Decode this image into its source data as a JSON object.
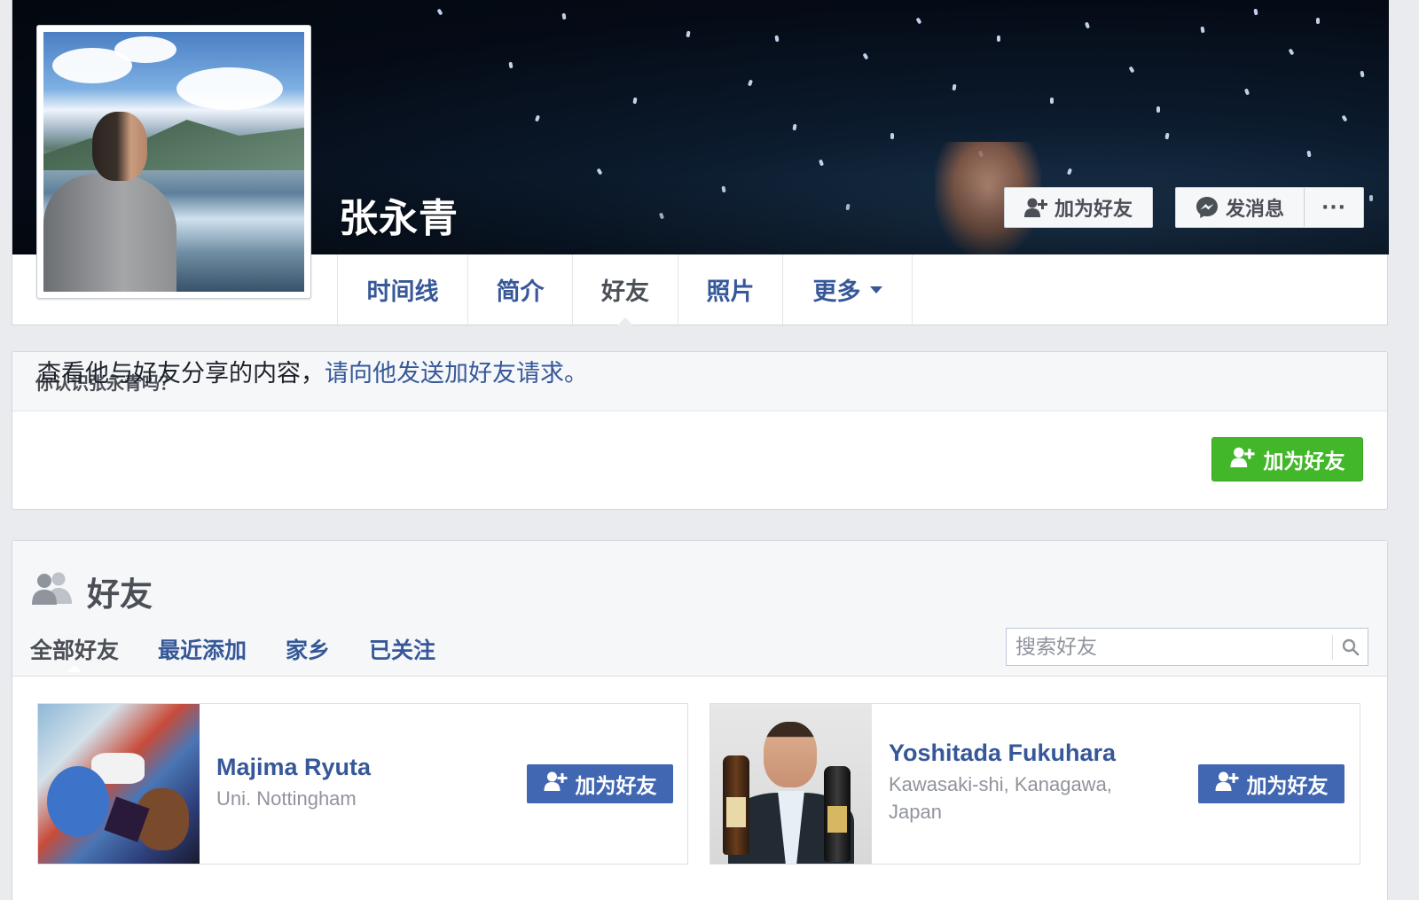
{
  "profile": {
    "name": "张永青",
    "cover_actions": {
      "add_friend": "加为好友",
      "message": "发消息",
      "more": "···"
    }
  },
  "nav": {
    "items": [
      {
        "label": "时间线"
      },
      {
        "label": "简介"
      },
      {
        "label": "好友"
      },
      {
        "label": "照片"
      },
      {
        "label": "更多"
      }
    ],
    "active": "好友"
  },
  "know_prompt": {
    "header": "你认识张永青吗？",
    "text": "查看他与好友分享的内容，",
    "link": "请向他发送加好友请求。",
    "button": "加为好友"
  },
  "friends": {
    "title": "好友",
    "tabs": [
      {
        "label": "全部好友"
      },
      {
        "label": "最近添加"
      },
      {
        "label": "家乡"
      },
      {
        "label": "已关注"
      }
    ],
    "active_tab": "全部好友",
    "search_placeholder": "搜索好友",
    "list": [
      {
        "name": "Majima Ryuta",
        "sub_line1": "Uni. Nottingham",
        "sub_line2": "",
        "button": "加为好友"
      },
      {
        "name": "Yoshitada Fukuhara",
        "sub_line1": "Kawasaki-shi, Kanagawa,",
        "sub_line2": "Japan",
        "button": "加为好友"
      }
    ]
  },
  "colors": {
    "link_blue": "#365899",
    "button_blue": "#4267b2",
    "button_green": "#42b72a",
    "page_bg": "#e9ebee"
  }
}
